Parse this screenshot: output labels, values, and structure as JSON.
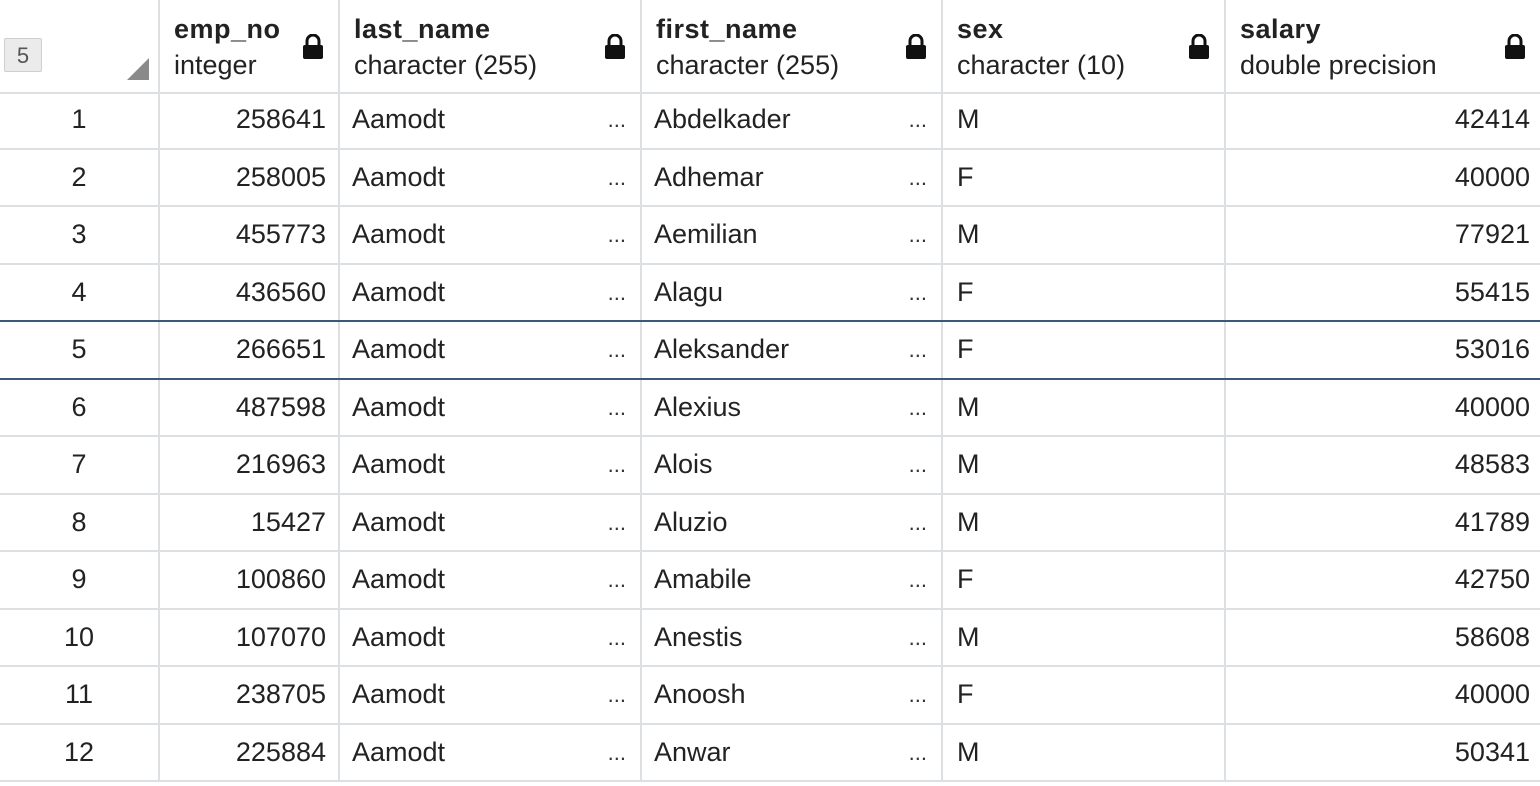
{
  "grid": {
    "selected_row_badge": "5",
    "columns": [
      {
        "name": "emp_no",
        "type": "integer"
      },
      {
        "name": "last_name",
        "type": "character (255)"
      },
      {
        "name": "first_name",
        "type": "character (255)"
      },
      {
        "name": "sex",
        "type": "character (10)"
      },
      {
        "name": "salary",
        "type": "double precision"
      }
    ],
    "ellipsis": "...",
    "rows": [
      {
        "rn": "1",
        "emp_no": "258641",
        "last_name": "Aamodt",
        "first_name": "Abdelkader",
        "sex": "M",
        "salary": "42414"
      },
      {
        "rn": "2",
        "emp_no": "258005",
        "last_name": "Aamodt",
        "first_name": "Adhemar",
        "sex": "F",
        "salary": "40000"
      },
      {
        "rn": "3",
        "emp_no": "455773",
        "last_name": "Aamodt",
        "first_name": "Aemilian",
        "sex": "M",
        "salary": "77921"
      },
      {
        "rn": "4",
        "emp_no": "436560",
        "last_name": "Aamodt",
        "first_name": "Alagu",
        "sex": "F",
        "salary": "55415"
      },
      {
        "rn": "5",
        "emp_no": "266651",
        "last_name": "Aamodt",
        "first_name": "Aleksander",
        "sex": "F",
        "salary": "53016"
      },
      {
        "rn": "6",
        "emp_no": "487598",
        "last_name": "Aamodt",
        "first_name": "Alexius",
        "sex": "M",
        "salary": "40000"
      },
      {
        "rn": "7",
        "emp_no": "216963",
        "last_name": "Aamodt",
        "first_name": "Alois",
        "sex": "M",
        "salary": "48583"
      },
      {
        "rn": "8",
        "emp_no": "15427",
        "last_name": "Aamodt",
        "first_name": "Aluzio",
        "sex": "M",
        "salary": "41789"
      },
      {
        "rn": "9",
        "emp_no": "100860",
        "last_name": "Aamodt",
        "first_name": "Amabile",
        "sex": "F",
        "salary": "42750"
      },
      {
        "rn": "10",
        "emp_no": "107070",
        "last_name": "Aamodt",
        "first_name": "Anestis",
        "sex": "M",
        "salary": "58608"
      },
      {
        "rn": "11",
        "emp_no": "238705",
        "last_name": "Aamodt",
        "first_name": "Anoosh",
        "sex": "F",
        "salary": "40000"
      },
      {
        "rn": "12",
        "emp_no": "225884",
        "last_name": "Aamodt",
        "first_name": "Anwar",
        "sex": "M",
        "salary": "50341"
      }
    ],
    "selected_index": 4,
    "icons": {
      "lock": "lock-icon",
      "sort": "sort-indicator-icon"
    },
    "colors": {
      "grid_line": "#dde0e3",
      "selection_border": "#3b5a7a"
    }
  }
}
